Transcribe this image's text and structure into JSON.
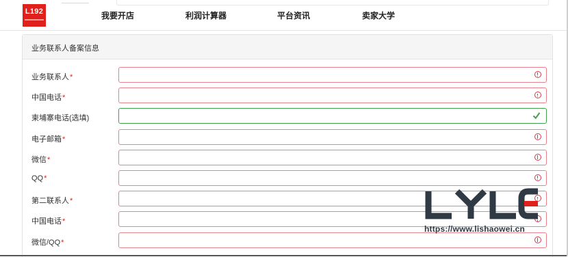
{
  "header": {
    "logo_text": "L192",
    "nav": [
      "我要开店",
      "利润计算器",
      "平台资讯",
      "卖家大学"
    ]
  },
  "panel": {
    "title": "业务联系人备案信息",
    "fields": [
      {
        "label": "业务联系人",
        "required": true,
        "state": "error",
        "value": ""
      },
      {
        "label": "中国电话",
        "required": true,
        "state": "error",
        "value": ""
      },
      {
        "label": "柬埔寨电话(选填)",
        "required": false,
        "state": "valid",
        "value": ""
      },
      {
        "label": "电子邮箱",
        "required": true,
        "state": "error",
        "value": ""
      },
      {
        "label": "微信",
        "required": true,
        "state": "error",
        "value": ""
      },
      {
        "label": "QQ",
        "required": true,
        "state": "error",
        "value": ""
      },
      {
        "label": "第二联系人",
        "required": true,
        "state": "error",
        "value": ""
      },
      {
        "label": "中国电话",
        "required": true,
        "state": "error",
        "value": ""
      },
      {
        "label": "微信/QQ",
        "required": true,
        "state": "error",
        "value": ""
      }
    ],
    "required_mark": "*"
  },
  "watermark": {
    "brand": "LYLE",
    "url": "https://www.lishaowei.cn"
  },
  "colors": {
    "logo_bg": "#e0201b",
    "error": "#dc3545",
    "error_border": "#e7818c",
    "valid": "#3fa34d"
  }
}
